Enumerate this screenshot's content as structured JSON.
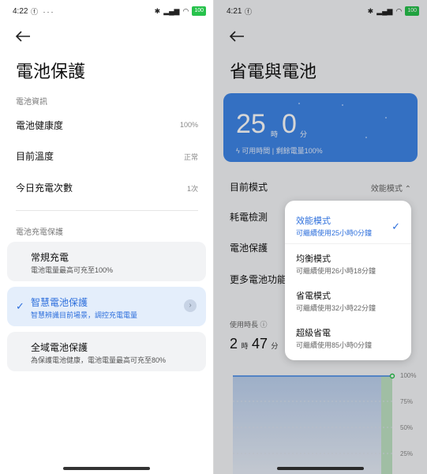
{
  "left": {
    "status": {
      "time": "4:22",
      "icons": "ⓕ ···",
      "battery": "100"
    },
    "title": "電池保護",
    "info_section": "電池資訊",
    "rows": [
      {
        "label": "電池健康度",
        "value": "100%"
      },
      {
        "label": "目前溫度",
        "value": "正常"
      },
      {
        "label": "今日充電次數",
        "value": "1次"
      }
    ],
    "protect_section": "電池充電保護",
    "cards": [
      {
        "title": "常規充電",
        "subtitle": "電池電量最高可充至100%",
        "selected": false
      },
      {
        "title": "智慧電池保護",
        "subtitle": "智慧辨識目前場景，調控充電電量",
        "selected": true
      },
      {
        "title": "全域電池保護",
        "subtitle": "為保護電池健康，電池電量最高可充至80%",
        "selected": false
      }
    ],
    "check_mark": "✓",
    "chevron": "›"
  },
  "right": {
    "status": {
      "time": "4:21",
      "icons": "ⓕ",
      "battery": "100"
    },
    "title": "省電與電池",
    "battery_card": {
      "hours": "25",
      "hours_unit": "時",
      "minutes": "0",
      "minutes_unit": "分",
      "subtitle": "可用時間 | 剩餘電量100%"
    },
    "rows": {
      "mode_label": "目前模式",
      "mode_value": "效能模式 ⌃",
      "power_check": "耗電檢測",
      "battery_protect": "電池保護",
      "more_features": "更多電池功能"
    },
    "usage": {
      "label": "使用時長 ⓘ",
      "hours": "2",
      "hours_unit": "時",
      "minutes": "47",
      "minutes_unit": "分"
    },
    "chart_ticks": [
      "100%",
      "75%",
      "50%",
      "25%"
    ],
    "dropdown": {
      "options": [
        {
          "title": "效能模式",
          "subtitle": "可繼續使用25小時0分鐘",
          "selected": true
        },
        {
          "title": "均衡模式",
          "subtitle": "可繼續使用26小時18分鐘",
          "selected": false
        },
        {
          "title": "省電模式",
          "subtitle": "可繼續使用32小時22分鐘",
          "selected": false
        },
        {
          "title": "超級省電",
          "subtitle": "可繼續使用85小時0分鐘",
          "selected": false
        }
      ],
      "check_mark": "✓"
    }
  },
  "colors": {
    "accent": "#2d6fdc",
    "battery_card": "#3f86e8",
    "battery_full": "#27c24c"
  }
}
